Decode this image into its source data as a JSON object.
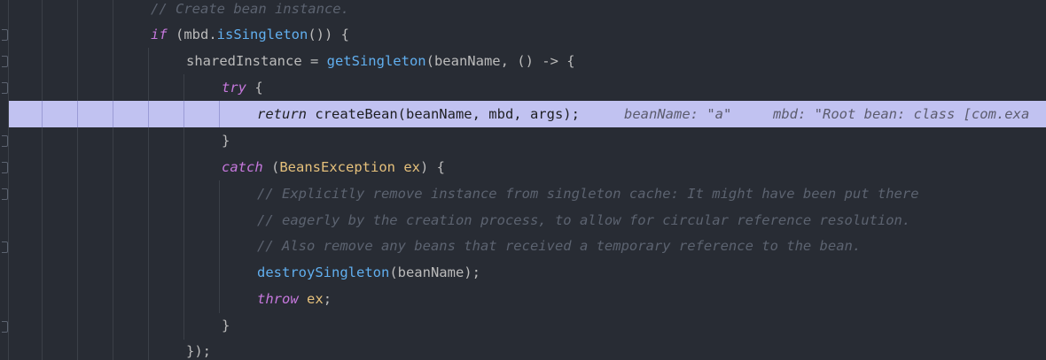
{
  "editor": {
    "lines": [
      {
        "parts": [
          {
            "t": "// Create bean instance.",
            "c": "cm"
          }
        ]
      },
      {
        "parts": [
          {
            "t": "if",
            "c": "kw"
          },
          {
            "t": " (mbd.",
            "c": "id"
          },
          {
            "t": "isSingleton",
            "c": "fn"
          },
          {
            "t": "()) {",
            "c": "id"
          }
        ]
      },
      {
        "parts": [
          {
            "t": "sharedInstance = ",
            "c": "id"
          },
          {
            "t": "getSingleton",
            "c": "fn"
          },
          {
            "t": "(beanName, () -> {",
            "c": "id"
          }
        ]
      },
      {
        "parts": [
          {
            "t": "try",
            "c": "kw"
          },
          {
            "t": " {",
            "c": "id"
          }
        ]
      },
      {
        "parts": [
          {
            "t": "return",
            "c": "kw"
          },
          {
            "t": " createBean(beanName, mbd, args);",
            "c": "id"
          }
        ]
      },
      {
        "parts": [
          {
            "t": "}",
            "c": "id"
          }
        ]
      },
      {
        "parts": [
          {
            "t": "catch",
            "c": "kw"
          },
          {
            "t": " (",
            "c": "id"
          },
          {
            "t": "BeansException",
            "c": "ty"
          },
          {
            "t": " ",
            "c": "id"
          },
          {
            "t": "ex",
            "c": "var"
          },
          {
            "t": ") {",
            "c": "id"
          }
        ]
      },
      {
        "parts": [
          {
            "t": "// Explicitly remove instance from singleton cache: It might have been put there",
            "c": "cm"
          }
        ]
      },
      {
        "parts": [
          {
            "t": "// eagerly by the creation process, to allow for circular reference resolution.",
            "c": "cm"
          }
        ]
      },
      {
        "parts": [
          {
            "t": "// Also remove any beans that received a temporary reference to the bean.",
            "c": "cm"
          }
        ]
      },
      {
        "parts": [
          {
            "t": "destroySingleton",
            "c": "fn"
          },
          {
            "t": "(beanName);",
            "c": "id"
          }
        ]
      },
      {
        "parts": [
          {
            "t": "throw",
            "c": "kw"
          },
          {
            "t": " ",
            "c": "id"
          },
          {
            "t": "ex",
            "c": "var"
          },
          {
            "t": ";",
            "c": "id"
          }
        ]
      },
      {
        "parts": [
          {
            "t": "}",
            "c": "id"
          }
        ]
      },
      {
        "parts": [
          {
            "t": "});",
            "c": "id"
          }
        ]
      }
    ],
    "debugger_hints": [
      "beanName: \"a\"",
      "mbd: \"Root bean: class [com.exa"
    ]
  }
}
